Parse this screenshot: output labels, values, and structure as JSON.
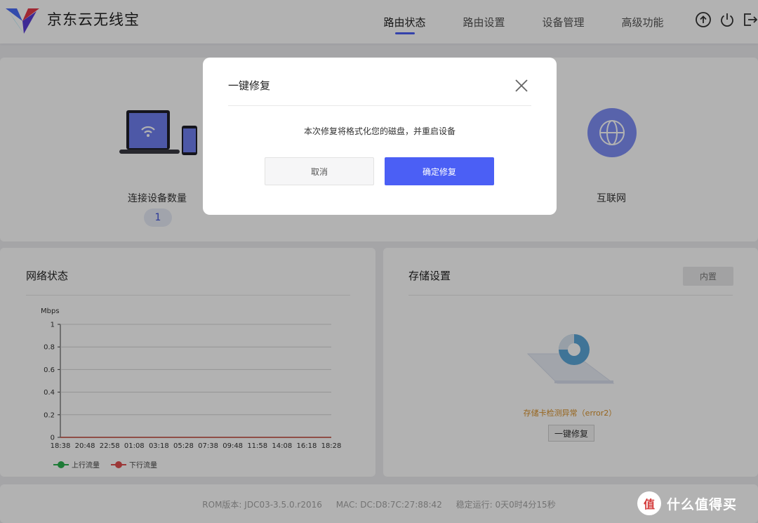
{
  "header": {
    "app_title": "京东云无线宝",
    "nav": [
      "路由状态",
      "路由设置",
      "设备管理",
      "高级功能"
    ]
  },
  "devices": {
    "label": "连接设备数量",
    "count": "1"
  },
  "internet": {
    "label": "互联网"
  },
  "network_panel": {
    "title": "网络状态"
  },
  "chart_data": {
    "type": "line",
    "ylabel": "Mbps",
    "ylim": [
      0,
      1
    ],
    "yticks": [
      "0",
      "0.2",
      "0.4",
      "0.6",
      "0.8",
      "1"
    ],
    "x": [
      "18:38",
      "20:48",
      "22:58",
      "01:08",
      "03:18",
      "05:28",
      "07:38",
      "09:48",
      "11:58",
      "14:08",
      "16:18",
      "18:28"
    ],
    "series": [
      {
        "name": "上行流量",
        "color": "#2bb04f",
        "values": [
          0,
          0,
          0,
          0,
          0,
          0,
          0,
          0,
          0,
          0,
          0,
          0
        ]
      },
      {
        "name": "下行流量",
        "color": "#e05050",
        "values": [
          0,
          0,
          0,
          0,
          0,
          0,
          0,
          0,
          0,
          0,
          0,
          0
        ]
      }
    ]
  },
  "storage": {
    "title": "存储设置",
    "chip": "内置",
    "error": "存储卡检测异常（error2）",
    "fix_label": "一键修复"
  },
  "footer": {
    "rom": "ROM版本: JDC03-3.5.0.r2016",
    "mac": "MAC: DC:D8:7C:27:88:42",
    "uptime": "稳定运行: 0天0时4分15秒"
  },
  "dialog": {
    "title": "一键修复",
    "message": "本次修复将格式化您的磁盘，并重启设备",
    "cancel": "取消",
    "confirm": "确定修复"
  },
  "watermark": {
    "glyph": "值",
    "text": "什么值得买"
  },
  "colors": {
    "accent": "#4b5ff5",
    "warning": "#d8912a",
    "upload": "#2bb04f",
    "download": "#e05050"
  }
}
